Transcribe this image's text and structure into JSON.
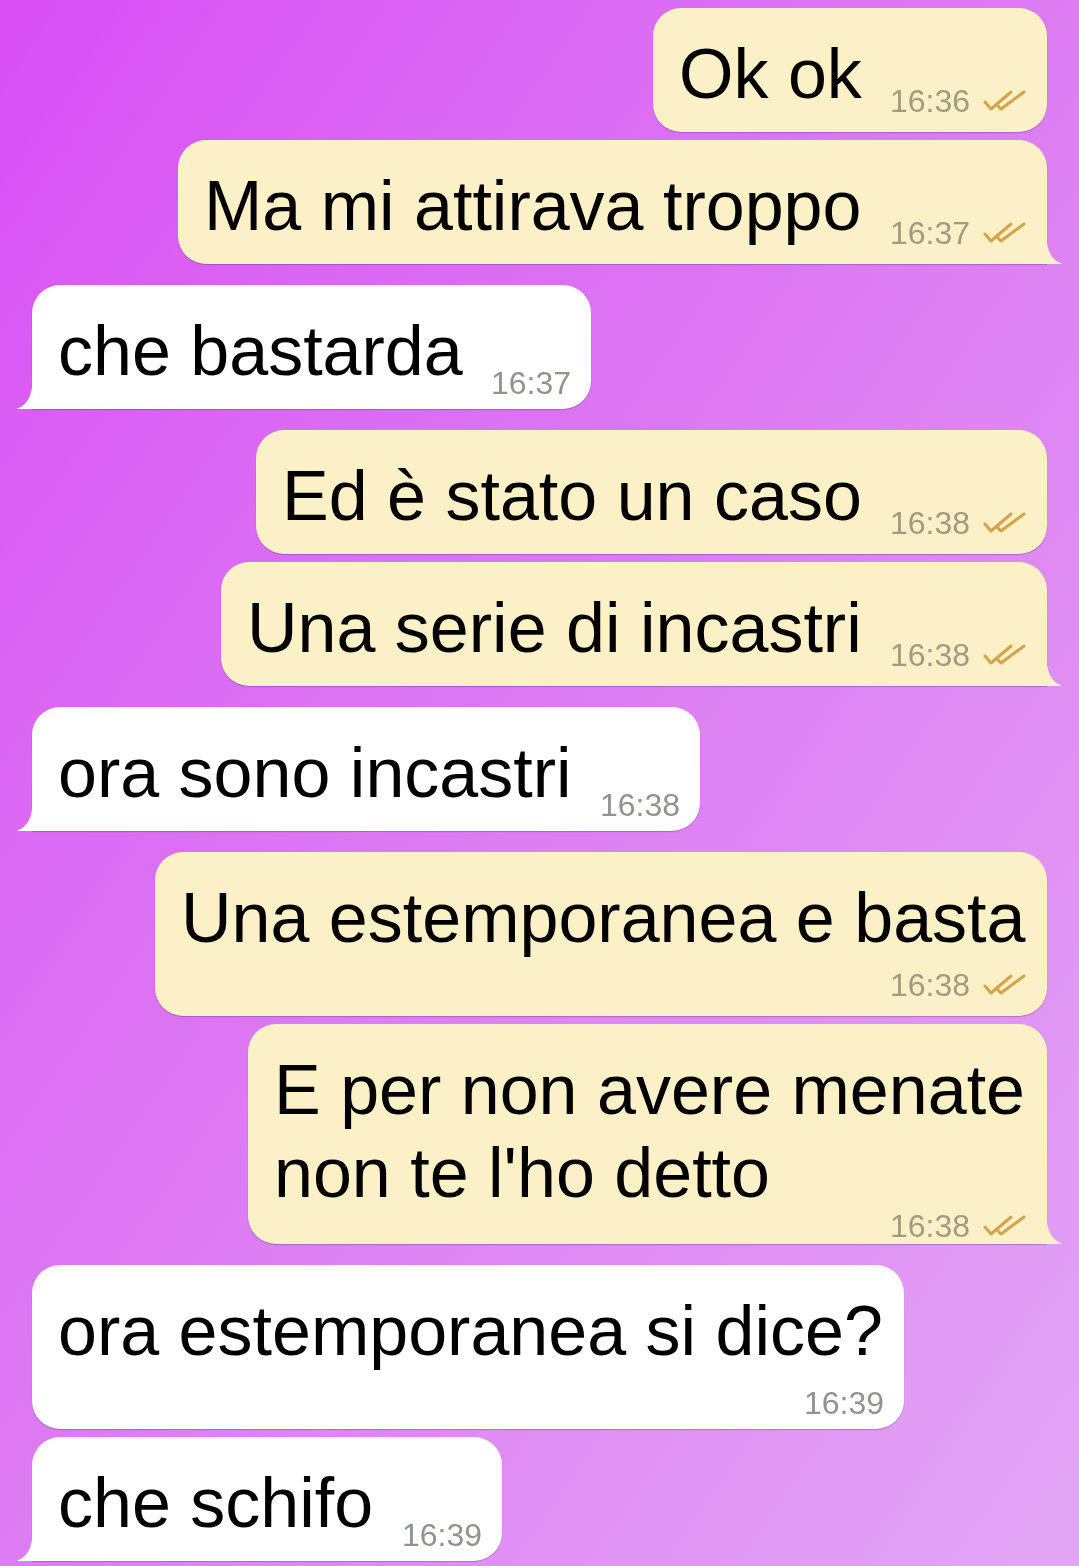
{
  "messages": [
    {
      "kind": "outgoing",
      "text": "Ok ok",
      "time": "16:36",
      "read": true,
      "tail": false
    },
    {
      "kind": "outgoing",
      "text": "Ma mi attirava troppo",
      "time": "16:37",
      "read": true,
      "tail": true
    },
    {
      "kind": "incoming",
      "text": "che bastarda",
      "time": "16:37",
      "tail": true
    },
    {
      "kind": "outgoing",
      "text": "Ed è stato un caso",
      "time": "16:38",
      "read": true,
      "tail": false
    },
    {
      "kind": "outgoing",
      "text": "Una serie di incastri",
      "time": "16:38",
      "read": true,
      "tail": true
    },
    {
      "kind": "incoming",
      "text": "ora sono incastri",
      "time": "16:38",
      "tail": true
    },
    {
      "kind": "outgoing",
      "text": "Una estemporanea e basta",
      "time": "16:38",
      "read": true,
      "tail": false
    },
    {
      "kind": "outgoing",
      "text": "E per non avere menate non te l'ho detto",
      "time": "16:38",
      "read": true,
      "tail": true
    },
    {
      "kind": "incoming",
      "text": "ora estemporanea si dice?",
      "time": "16:39",
      "tail": false
    },
    {
      "kind": "incoming",
      "text": "che schifo",
      "time": "16:39",
      "tail": true
    }
  ]
}
